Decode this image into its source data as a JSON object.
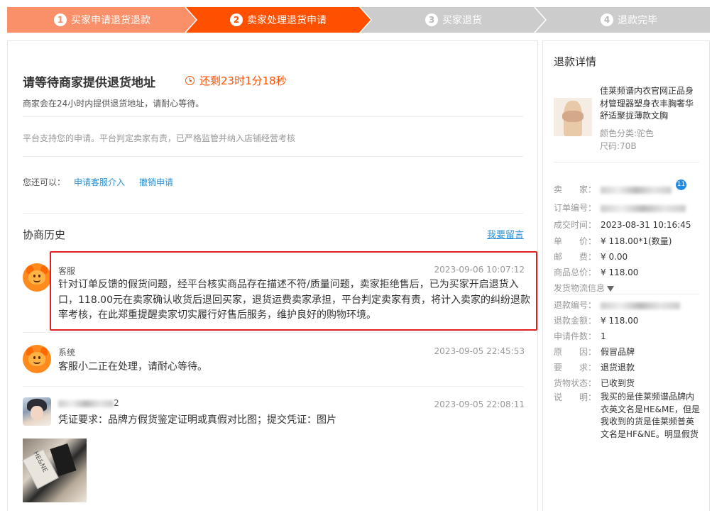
{
  "steps": [
    {
      "num": "1",
      "label": "买家申请退货退款"
    },
    {
      "num": "2",
      "label": "卖家处理退货申请"
    },
    {
      "num": "3",
      "label": "买家退货"
    },
    {
      "num": "4",
      "label": "退款完毕"
    }
  ],
  "colors": {
    "step_done": "#f9906a",
    "step_active": "#ff5000",
    "step_todo": "#cccccc",
    "accent": "#ff5000",
    "link": "#2a8fd4",
    "highlight": "#e02020"
  },
  "status": {
    "title": "请等待商家提供退货地址",
    "countdown": "还剩23时1分18秒",
    "desc": "商家会在24小时内提供退货地址，请耐心等待。",
    "notice": "平台支持您的申请。平台判定卖家有责，已严格监管并纳入店铺经营考核"
  },
  "actions": {
    "lead": "您还可以：",
    "service": "申请客服介入",
    "cancel": "撤销申请"
  },
  "history": {
    "title": "协商历史",
    "leave_message": "我要留言",
    "records": [
      {
        "name": "客服",
        "time": "2023-09-06 10:07:12",
        "text": "针对订单反馈的假货问题，经平台核实商品存在描述不符/质量问题，卖家拒绝售后，已为买家开启退货入口，118.00元在卖家确认收货后退回买家，退货运费卖家承担，平台判定卖家有责，将计入卖家的纠纷退款率考核，在此郑重提醒卖家切实履行好售后服务，维护良好的购物环境。"
      },
      {
        "name": "系统",
        "time": "2023-09-05 22:45:53",
        "text": "客服小二正在处理，请耐心等待。"
      },
      {
        "name": "2",
        "time": "2023-09-05 22:08:11",
        "text": "凭证要求：品牌方假货鉴定证明或真假对比图；提交凭证：图片",
        "proof_text": "HE&NE"
      }
    ]
  },
  "sidebar": {
    "title": "退款详情",
    "product_name": "佳莱频谱内衣官网正品身材管理器塑身衣丰胸奢华舒适聚拢薄款文胸",
    "color_attr": "颜色分类:驼色",
    "size_attr": "尺码:70B",
    "badge": "11",
    "fields": {
      "seller": {
        "k": "卖　　家：",
        "v": ""
      },
      "order_no": {
        "k": "订单编号：",
        "v": ""
      },
      "deal_time": {
        "k": "成交时间：",
        "v": "2023-08-31 10:16:45"
      },
      "price": {
        "k": "单　　价：",
        "v": "¥ 118.00*1(数量)"
      },
      "postage": {
        "k": "邮　　费：",
        "v": "¥ 0.00"
      },
      "total": {
        "k": "商品总价：",
        "v": "¥ 118.00"
      },
      "logistics": {
        "k": "发货物流信息",
        "v": ""
      },
      "refund_no": {
        "k": "退款编号：",
        "v": ""
      },
      "refund_amount": {
        "k": "退款金额：",
        "v": "¥ 118.00"
      },
      "apply_count": {
        "k": "申请件数：",
        "v": "1"
      },
      "reason": {
        "k": "原　　因：",
        "v": "假冒品牌"
      },
      "request": {
        "k": "要　　求：",
        "v": "退货退款"
      },
      "goods_status": {
        "k": "货物状态：",
        "v": "已收到货"
      },
      "note": {
        "k": "说　　明：",
        "v": "我买的是佳莱频谱品牌内衣英文名是HE&ME，但是我收到的货是佳莱频普英文名是HF&NE。明显假货"
      }
    }
  }
}
